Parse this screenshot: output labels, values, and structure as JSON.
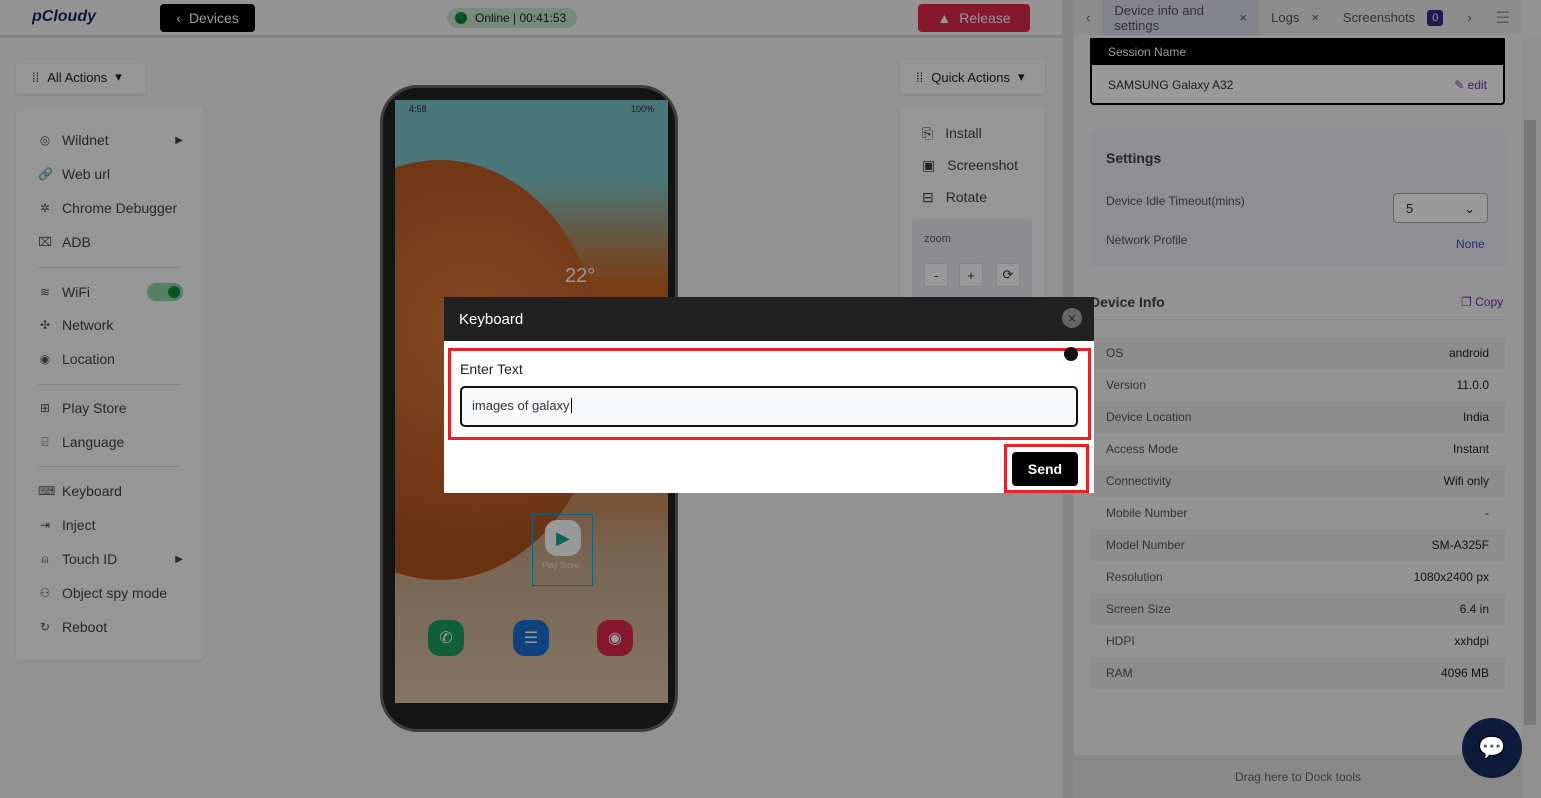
{
  "header": {
    "logo": "pCloudy",
    "devices_label": "Devices",
    "status": "Online | 00:41:53",
    "release_label": "Release"
  },
  "left": {
    "all_actions": "All Actions",
    "items": [
      {
        "label": "Wildnet",
        "icon": "wifi-signal-icon",
        "submenu": true
      },
      {
        "label": "Web url",
        "icon": "link-icon"
      },
      {
        "label": "Chrome Debugger",
        "icon": "bug-icon"
      },
      {
        "label": "ADB",
        "icon": "terminal-icon"
      },
      {
        "label": "WiFi",
        "icon": "wifi-icon",
        "toggle": true
      },
      {
        "label": "Network",
        "icon": "network-icon"
      },
      {
        "label": "Location",
        "icon": "location-icon"
      },
      {
        "label": "Play Store",
        "icon": "apps-icon"
      },
      {
        "label": "Language",
        "icon": "language-icon"
      },
      {
        "label": "Keyboard",
        "icon": "keyboard-icon"
      },
      {
        "label": "Inject",
        "icon": "inject-icon"
      },
      {
        "label": "Touch ID",
        "icon": "fingerprint-icon",
        "submenu": true
      },
      {
        "label": "Object spy mode",
        "icon": "spy-icon"
      },
      {
        "label": "Reboot",
        "icon": "reboot-icon"
      }
    ]
  },
  "quick": {
    "label": "Quick Actions",
    "items": [
      "Install",
      "Screenshot",
      "Rotate"
    ],
    "zoom_label": "zoom",
    "zoom_minus": "-",
    "zoom_plus": "+"
  },
  "phone": {
    "time": "4:58",
    "battery": "100%",
    "weather": "22°",
    "play_store": "Play Store"
  },
  "right": {
    "tabs": [
      {
        "label": "Device info and settings",
        "close": "×"
      },
      {
        "label": "Logs",
        "close": "×"
      },
      {
        "label": "Screenshots",
        "badge": "0"
      }
    ],
    "session_header": "Session Name",
    "session_name": "SAMSUNG Galaxy A32",
    "edit": "edit",
    "settings_title": "Settings",
    "idle_label": "Device Idle Timeout(mins)",
    "idle_value": "5",
    "network_label": "Network Profile",
    "network_value": "None",
    "device_info_title": "Device Info",
    "copy": "Copy",
    "rows": [
      [
        "OS",
        "android"
      ],
      [
        "Version",
        "11.0.0"
      ],
      [
        "Device Location",
        "India"
      ],
      [
        "Access Mode",
        "Instant"
      ],
      [
        "Connectivity",
        "Wifi only"
      ],
      [
        "Mobile Number",
        "-"
      ],
      [
        "Model Number",
        "SM-A325F"
      ],
      [
        "Resolution",
        "1080x2400 px"
      ],
      [
        "Screen Size",
        "6.4 in"
      ],
      [
        "HDPI",
        "xxhdpi"
      ],
      [
        "RAM",
        "4096 MB"
      ]
    ],
    "dock": "Drag here to Dock tools"
  },
  "modal": {
    "title": "Keyboard",
    "label": "Enter Text",
    "value": "images of galaxy",
    "send": "Send"
  },
  "colors": {
    "highlight": "#e8202a",
    "release": "#e0294e",
    "online": "#0a8a3c"
  }
}
